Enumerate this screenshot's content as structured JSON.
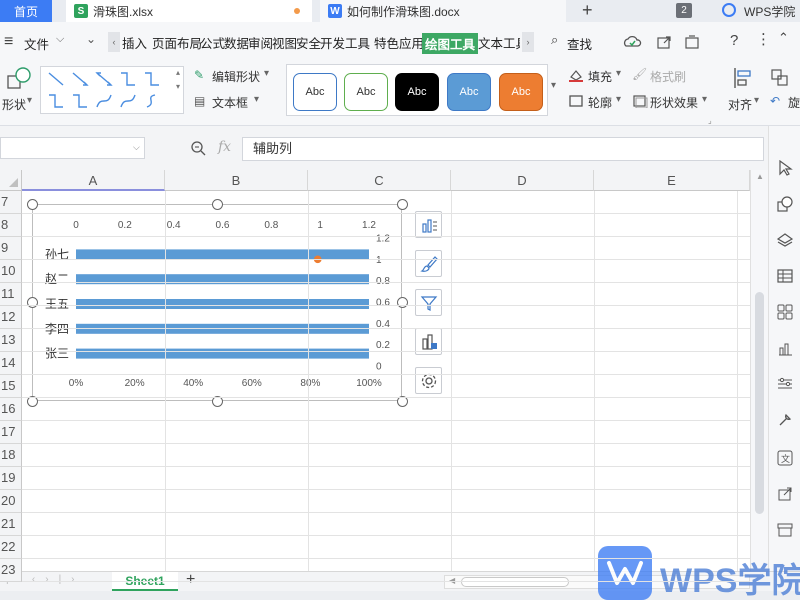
{
  "tabs": {
    "home": "首页",
    "xlsx": "滑珠图.xlsx",
    "docx": "如何制作滑珠图.docx",
    "add": "+",
    "count": "2",
    "brand": "WPS学院"
  },
  "menu": {
    "file": "文件",
    "items": [
      "插入",
      "页面布局",
      "公式",
      "数据",
      "审阅",
      "视图",
      "安全",
      "开发工具",
      "特色应用",
      "绘图工具",
      "文本工具"
    ],
    "active_item": "绘图工具",
    "search": "查找"
  },
  "ribbon": {
    "shape": "形状",
    "edit_shape": "编辑形状",
    "text_box": "文本框",
    "style_label": "Abc",
    "fill": "填充",
    "format_painter": "格式刷",
    "outline": "轮廓",
    "shape_effects": "形状效果",
    "align": "对齐",
    "rotate": "旋"
  },
  "formula_bar": {
    "fx": "fx",
    "value": "辅助列"
  },
  "columns": [
    "A",
    "B",
    "C",
    "D",
    "E"
  ],
  "rows": [
    "7",
    "8",
    "9",
    "10",
    "11",
    "12",
    "13",
    "14",
    "15",
    "16",
    "17",
    "18",
    "19",
    "20",
    "21",
    "22",
    "23"
  ],
  "chart_data": {
    "type": "bar",
    "categories": [
      "张三",
      "李四",
      "王五",
      "赵二",
      "孙七"
    ],
    "series": [
      {
        "values": [
          1,
          1,
          1,
          1,
          1
        ]
      },
      {
        "type": "scatter",
        "points": [
          {
            "x": 0.99,
            "y": 1
          }
        ]
      }
    ],
    "top_axis_ticks": [
      "0",
      "0.2",
      "0.4",
      "0.6",
      "0.8",
      "1",
      "1.2"
    ],
    "bottom_axis_ticks": [
      "0%",
      "20%",
      "40%",
      "60%",
      "80%",
      "100%"
    ],
    "right_axis_ticks": [
      "1.2",
      "1",
      "0.8",
      "0.6",
      "0.4",
      "0.2",
      "0"
    ],
    "bar_color": "#5b9bd5",
    "point_color": "#ed7d31",
    "title": "",
    "legend": "none",
    "grid": false
  },
  "sheets": {
    "active": "Sheet1",
    "add": "+"
  },
  "watermark": "WPS学院"
}
